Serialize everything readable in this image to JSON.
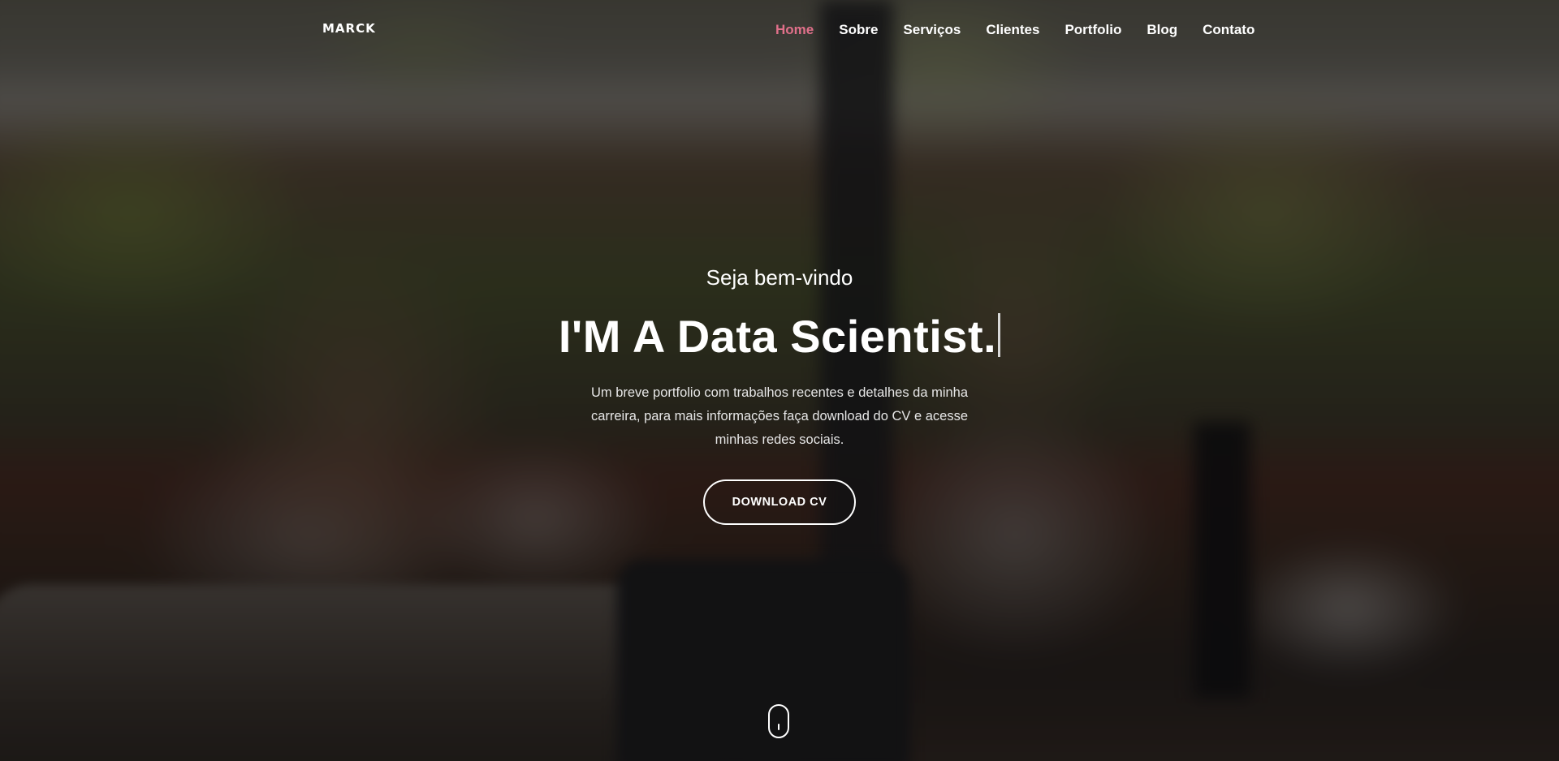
{
  "brand": {
    "logo_text": "MARCK"
  },
  "nav": {
    "items": [
      {
        "label": "Home",
        "active": true
      },
      {
        "label": "Sobre",
        "active": false
      },
      {
        "label": "Serviços",
        "active": false
      },
      {
        "label": "Clientes",
        "active": false
      },
      {
        "label": "Portfolio",
        "active": false
      },
      {
        "label": "Blog",
        "active": false
      },
      {
        "label": "Contato",
        "active": false
      }
    ],
    "active_color": "#e0708a"
  },
  "hero": {
    "welcome": "Seja bem-vindo",
    "headline": "I'M A Data Scientist.",
    "description": "Um breve portfolio com trabalhos recentes e detalhes da minha carreira, para mais informações faça download do CV e acesse minhas redes sociais.",
    "cta_label": "DOWNLOAD CV"
  },
  "scroll_indicator": {
    "icon": "mouse-scroll-icon"
  }
}
